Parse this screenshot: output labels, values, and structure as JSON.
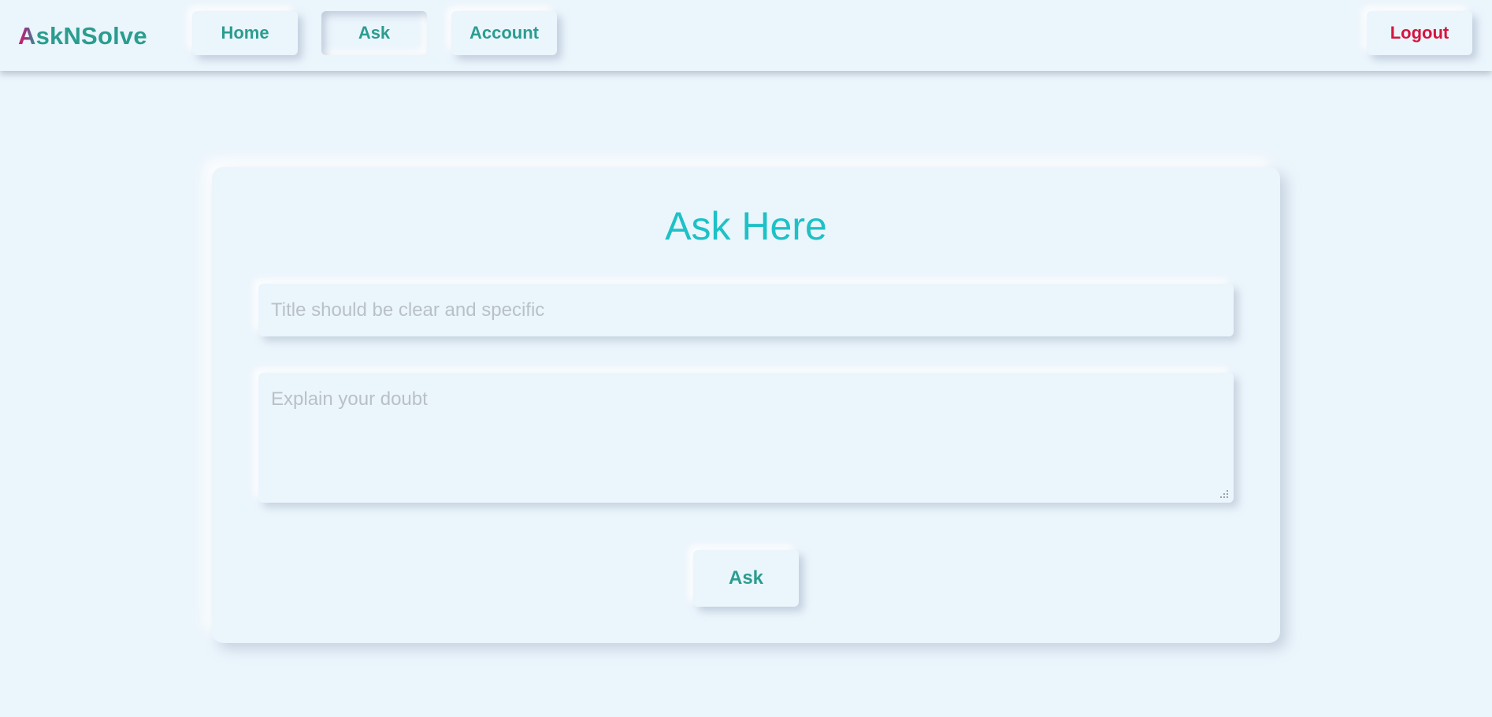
{
  "brand": {
    "initial": "A",
    "rest": "skNSolve"
  },
  "nav": {
    "home": "Home",
    "ask": "Ask",
    "account": "Account",
    "logout": "Logout",
    "active": "ask"
  },
  "form": {
    "heading": "Ask Here",
    "title_value": "",
    "title_placeholder": "Title should be clear and specific",
    "doubt_value": "",
    "doubt_placeholder": "Explain your doubt",
    "submit_label": "Ask"
  },
  "colors": {
    "background": "#ebf5fc",
    "accent": "#2a9d8f",
    "heading": "#1dc1c6",
    "logout": "#d6143f",
    "placeholder": "#b9c0c8"
  },
  "icons": {
    "resize_handle": "resize-grip-icon"
  }
}
